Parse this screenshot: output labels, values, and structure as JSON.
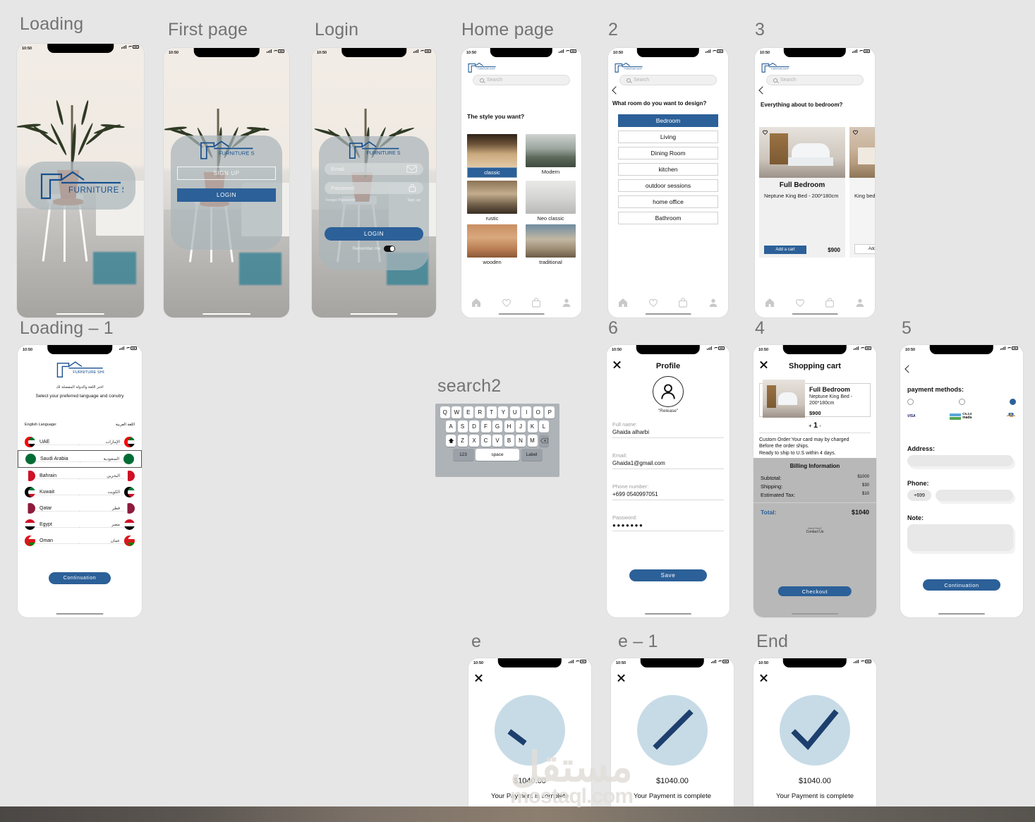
{
  "canvas": {
    "background": "#e6e6e6",
    "accent": "#2c6098"
  },
  "watermark": {
    "arabic": "مستقل",
    "latin": "mostaql.com"
  },
  "frames": [
    {
      "label": "Loading"
    },
    {
      "label": "First page"
    },
    {
      "label": "Login"
    },
    {
      "label": "Home page"
    },
    {
      "label": "2"
    },
    {
      "label": "3"
    },
    {
      "label": "Loading – 1"
    },
    {
      "label": "search2"
    },
    {
      "label": "6"
    },
    {
      "label": "4"
    },
    {
      "label": "5"
    },
    {
      "label": "e"
    },
    {
      "label": "e – 1"
    },
    {
      "label": "End"
    }
  ],
  "status_bar": {
    "time": "10:50",
    "signal": "signal-icon",
    "wifi": "wifi-icon",
    "battery": "battery-icon"
  },
  "brand": {
    "name": "FURNITURE SHOP"
  },
  "loading": {
    "logo_text": "FURNITURE SHOP"
  },
  "first_page": {
    "signup": "SIGN UP",
    "login": "LOGIN",
    "logo_text": "FURNITURE SHOP"
  },
  "login": {
    "logo_text": "FURNITURE SHOP",
    "email_placeholder": "Email",
    "password_placeholder": "Password",
    "forgot": "Forgot Password",
    "signup": "Sign up",
    "login_button": "LOGIN",
    "remember": "Remember me",
    "email_icon": "envelope-icon",
    "password_icon": "lock-icon"
  },
  "home_page": {
    "search_placeholder": "Search",
    "title": "The style you want?",
    "styles": [
      {
        "label": "classic",
        "selected": true
      },
      {
        "label": "Modern",
        "selected": false
      },
      {
        "label": "rustic",
        "selected": false
      },
      {
        "label": "Neo classic",
        "selected": false
      },
      {
        "label": "wooden",
        "selected": false
      },
      {
        "label": "traditional",
        "selected": false
      }
    ],
    "tabs": [
      "home-icon",
      "heart-icon",
      "bag-icon",
      "person-icon"
    ]
  },
  "rooms_page": {
    "search_placeholder": "Search",
    "title": "What room do you want to design?",
    "rooms": [
      {
        "label": "Bedroom",
        "selected": true
      },
      {
        "label": "Living",
        "selected": false
      },
      {
        "label": "Dining Room",
        "selected": false
      },
      {
        "label": "kitchen",
        "selected": false
      },
      {
        "label": "outdoor sessions",
        "selected": false
      },
      {
        "label": "home office",
        "selected": false
      },
      {
        "label": "Bathroom",
        "selected": false
      }
    ]
  },
  "products_page": {
    "search_placeholder": "Search",
    "title": "Everything about to bedroom?",
    "products": [
      {
        "name": "Full Bedroom",
        "desc": "Neptune King Bed - 200*180cm",
        "cta": "Add a cart",
        "price": "$900",
        "primary": true
      },
      {
        "name": "Full",
        "desc": "King bed Brooklyn",
        "cta": "Add a c",
        "price": "",
        "primary": false
      }
    ]
  },
  "language_page": {
    "logo_text": "FURNITURE SHOP",
    "arabic_subtitle": "اختر اللغة والدولة المفضلة لك",
    "subtitle": "Select your preferred language and conutry",
    "col_en": "English Language:",
    "col_ar": "اللغة العربية",
    "countries": [
      {
        "en": "UAE",
        "ar": "الإمارات",
        "selected": false
      },
      {
        "en": "Saudi Arabia",
        "ar": "السعودية",
        "selected": true
      },
      {
        "en": "Bahrain",
        "ar": "البحرين",
        "selected": false
      },
      {
        "en": "Kuwait",
        "ar": "الكويت",
        "selected": false
      },
      {
        "en": "Qatar",
        "ar": "قطر",
        "selected": false
      },
      {
        "en": "Egypt",
        "ar": "مصر",
        "selected": false
      },
      {
        "en": "Oman",
        "ar": "عمان",
        "selected": false
      }
    ],
    "cta": "Continuation"
  },
  "keyboard": {
    "row1": [
      "Q",
      "W",
      "E",
      "R",
      "T",
      "Y",
      "U",
      "I",
      "O",
      "P"
    ],
    "row2": [
      "A",
      "S",
      "D",
      "F",
      "G",
      "H",
      "J",
      "K",
      "L"
    ],
    "row3": [
      "Z",
      "X",
      "C",
      "V",
      "B",
      "N",
      "M"
    ],
    "shift": "shift-icon",
    "backspace": "backspace-icon",
    "numbers": "123",
    "space": "space",
    "label": "Label"
  },
  "profile_page": {
    "title": "Profile",
    "avatar_caption": "\"Release\"",
    "fields": [
      {
        "label": "Full name:",
        "value": "Ghaida alharbi"
      },
      {
        "label": "Email:",
        "value": "Ghaida1@gmail.com"
      },
      {
        "label": "Phone number:",
        "value": "+699  0540997051"
      },
      {
        "label": "Password:",
        "value": "●●●●●●●"
      }
    ],
    "save": "Save",
    "close_icon": "close-icon"
  },
  "cart_page": {
    "title": "Shopping cart",
    "item": {
      "name": "Full Bedroom",
      "desc": "Neptune King Bed - 200*180cm",
      "price": "$900"
    },
    "qty": {
      "minus": "-",
      "plus": "+",
      "value": "1"
    },
    "note": "Custom Order:Your card may by charged\nBefore the order ships.\nReady to ship to U.S within 4 days.",
    "billing_title": "Billing Information",
    "billing_rows": [
      {
        "label": "Subtotal:",
        "amount": "$1000"
      },
      {
        "label": "Shipping:",
        "amount": "$30"
      },
      {
        "label": "Estimated Tax:",
        "amount": "$10"
      }
    ],
    "total_label": "Total:",
    "total_amount": "$1040",
    "need_help": "Need Help?",
    "contact_us": "Contact Us",
    "checkout": "Checkout"
  },
  "payment_page": {
    "heading": "payment methods:",
    "methods": [
      {
        "name": "visa-icon",
        "label": "VISA",
        "selected": false
      },
      {
        "name": "mada-icon",
        "label": "mada",
        "sublabel": "C5.3.0",
        "selected": false
      },
      {
        "name": "cash-on-delivery-icon",
        "label": "",
        "selected": true
      }
    ],
    "address_label": "Address:",
    "address_value": "",
    "phone_label": "Phone:",
    "phone_code": "+699",
    "phone_value": "",
    "note_label": "Note:",
    "note_value": "",
    "cta": "Continuation"
  },
  "payment_complete": [
    {
      "amount": "$1040.00",
      "message": "Your Payment is complete",
      "state": "start"
    },
    {
      "amount": "$1040.00",
      "message": "Your Payment is complete",
      "state": "mid"
    },
    {
      "amount": "$1040.00",
      "message": "Your Payment is complete",
      "state": "done"
    }
  ]
}
